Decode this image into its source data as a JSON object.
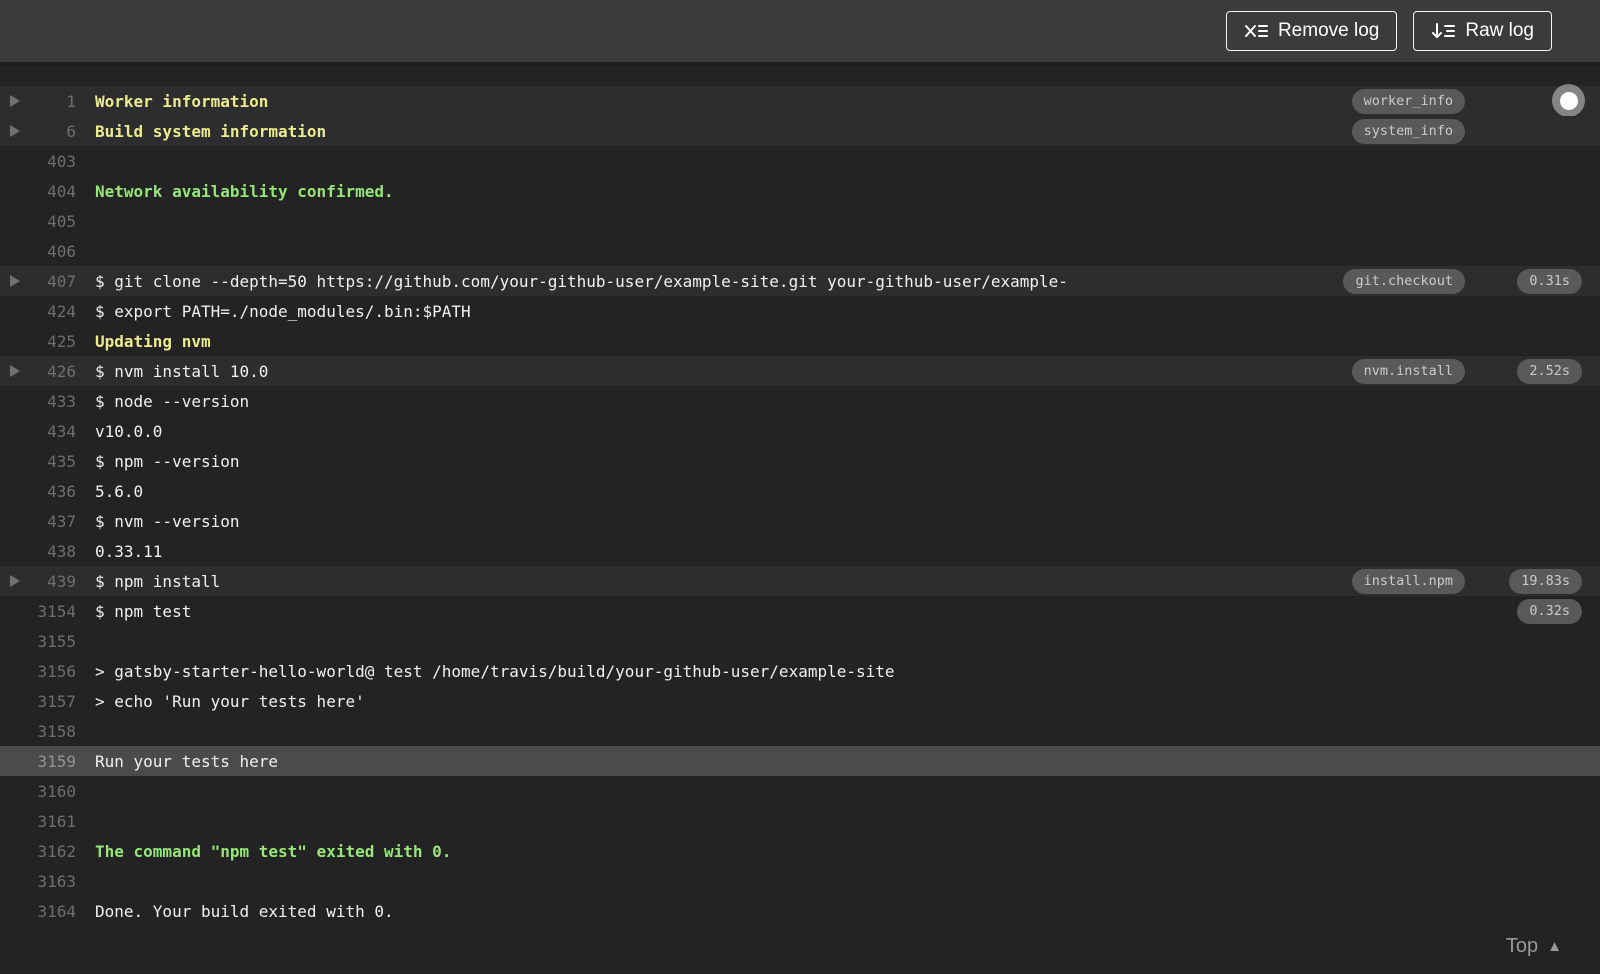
{
  "toolbar": {
    "remove_log_label": "Remove log",
    "raw_log_label": "Raw log"
  },
  "icons": {
    "remove_log": "x-with-list-lines",
    "raw_log": "arrow-down-with-list-lines",
    "fold": "triangle-right",
    "scroll_indicator": "circle-dot",
    "top": "▲"
  },
  "colors": {
    "bar-bg": "#3b3b3d",
    "log-bg": "#232323",
    "fold-row-bg": "#2d2d2f",
    "highlight-row-bg": "#4b4b4d",
    "text-color": "#f1f1f1",
    "num-color": "#6e6e70",
    "yellow": "#ECEC8E",
    "green": "#96E678",
    "pill-bg": "#59595b",
    "pill-text": "#cbcbcb"
  },
  "log": {
    "lines": [
      {
        "num": "1",
        "text": "Worker information",
        "style": "yellow",
        "fold": true,
        "tag": "worker_info",
        "scroll_indicator": true
      },
      {
        "num": "6",
        "text": "Build system information",
        "style": "yellow",
        "fold": true,
        "tag": "system_info"
      },
      {
        "num": "403",
        "text": ""
      },
      {
        "num": "404",
        "text": "Network availability confirmed.",
        "style": "green"
      },
      {
        "num": "405",
        "text": ""
      },
      {
        "num": "406",
        "text": ""
      },
      {
        "num": "407",
        "text": "$ git clone --depth=50 https://github.com/your-github-user/example-site.git your-github-user/example-",
        "fold": true,
        "tag": "git.checkout",
        "duration": "0.31s"
      },
      {
        "num": "424",
        "text": "$ export PATH=./node_modules/.bin:$PATH"
      },
      {
        "num": "425",
        "text": "Updating nvm",
        "style": "yellow"
      },
      {
        "num": "426",
        "text": "$ nvm install 10.0",
        "fold": true,
        "tag": "nvm.install",
        "duration": "2.52s"
      },
      {
        "num": "433",
        "text": "$ node --version"
      },
      {
        "num": "434",
        "text": "v10.0.0"
      },
      {
        "num": "435",
        "text": "$ npm --version"
      },
      {
        "num": "436",
        "text": "5.6.0"
      },
      {
        "num": "437",
        "text": "$ nvm --version"
      },
      {
        "num": "438",
        "text": "0.33.11"
      },
      {
        "num": "439",
        "text": "$ npm install",
        "fold": true,
        "tag": "install.npm",
        "duration": "19.83s"
      },
      {
        "num": "3154",
        "text": "$ npm test",
        "duration": "0.32s"
      },
      {
        "num": "3155",
        "text": ""
      },
      {
        "num": "3156",
        "text": "> gatsby-starter-hello-world@ test /home/travis/build/your-github-user/example-site"
      },
      {
        "num": "3157",
        "text": "> echo 'Run your tests here'"
      },
      {
        "num": "3158",
        "text": ""
      },
      {
        "num": "3159",
        "text": "Run your tests here",
        "highlighted": true
      },
      {
        "num": "3160",
        "text": ""
      },
      {
        "num": "3161",
        "text": ""
      },
      {
        "num": "3162",
        "text": "The command \"npm test\" exited with 0.",
        "style": "green"
      },
      {
        "num": "3163",
        "text": ""
      },
      {
        "num": "3164",
        "text": "Done. Your build exited with 0."
      }
    ]
  },
  "footer": {
    "top_label": "Top",
    "top_icon": "▲"
  }
}
